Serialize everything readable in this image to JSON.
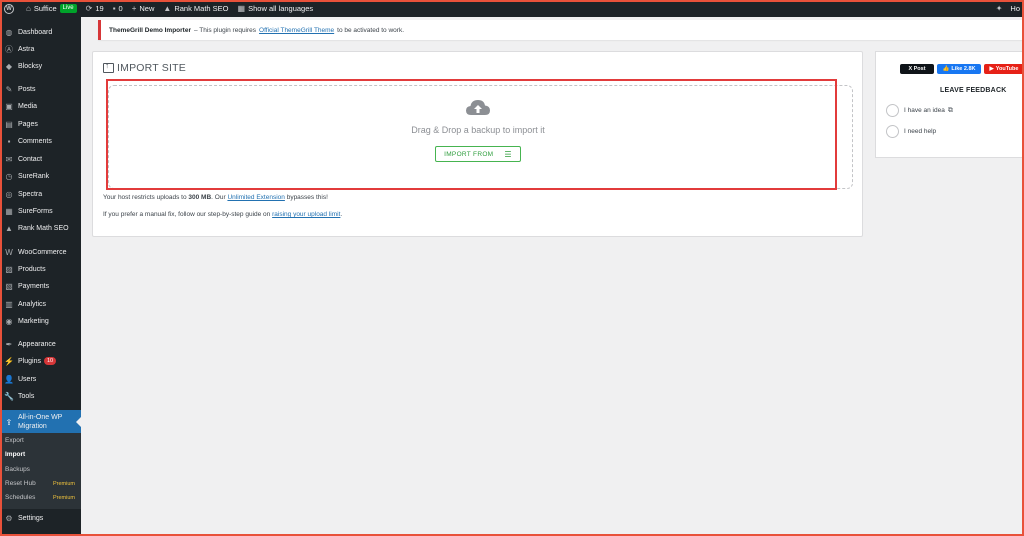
{
  "adminbar": {
    "site_name": "Suffice",
    "live_badge": "Live",
    "updates_count": "19",
    "comments_count": "0",
    "new_label": "New",
    "rankmath_label": "Rank Math SEO",
    "languages_label": "Show all languages",
    "howdy_label": "Ho"
  },
  "sidebar": {
    "items": [
      {
        "label": "Dashboard",
        "icon": "dashboard-icon"
      },
      {
        "label": "Astra",
        "icon": "astra-icon"
      },
      {
        "label": "Blocksy",
        "icon": "blocksy-icon"
      },
      {
        "label": "Posts",
        "icon": "pin-icon"
      },
      {
        "label": "Media",
        "icon": "media-icon"
      },
      {
        "label": "Pages",
        "icon": "pages-icon"
      },
      {
        "label": "Comments",
        "icon": "comments-icon"
      },
      {
        "label": "Contact",
        "icon": "mail-icon"
      },
      {
        "label": "SureRank",
        "icon": "surerank-icon"
      },
      {
        "label": "Spectra",
        "icon": "spectra-icon"
      },
      {
        "label": "SureForms",
        "icon": "sureforms-icon"
      },
      {
        "label": "Rank Math SEO",
        "icon": "rankmath-icon"
      },
      {
        "label": "WooCommerce",
        "icon": "woocommerce-icon"
      },
      {
        "label": "Products",
        "icon": "products-icon"
      },
      {
        "label": "Payments",
        "icon": "payments-icon"
      },
      {
        "label": "Analytics",
        "icon": "analytics-icon"
      },
      {
        "label": "Marketing",
        "icon": "marketing-icon"
      },
      {
        "label": "Appearance",
        "icon": "brush-icon"
      },
      {
        "label": "Plugins",
        "icon": "plugins-icon",
        "badge": "10"
      },
      {
        "label": "Users",
        "icon": "users-icon"
      },
      {
        "label": "Tools",
        "icon": "tools-icon"
      }
    ],
    "active_item": {
      "label_line1": "All-in-One WP",
      "label_line2": "Migration",
      "icon": "migration-icon"
    },
    "submenu": [
      {
        "label": "Export"
      },
      {
        "label": "Import",
        "current": true
      },
      {
        "label": "Backups"
      },
      {
        "label": "Reset Hub",
        "premium": "Premium"
      },
      {
        "label": "Schedules",
        "premium": "Premium"
      }
    ],
    "settings_label": "Settings"
  },
  "notice": {
    "title": "ThemeGrill Demo Importer",
    "text_before": "– This plugin requires",
    "link": "Official ThemeGrill Theme",
    "text_after": "to be activated to work."
  },
  "import": {
    "title": "IMPORT SITE",
    "drag_text": "Drag & Drop a backup to import it",
    "button_label": "IMPORT FROM",
    "info1_before": "Your host restricts uploads to",
    "info1_size": "300 MB",
    "info1_mid": ". Our",
    "info1_link": "Unlimited Extension",
    "info1_after": "bypasses this!",
    "info2_before": "If you prefer a manual fix, follow our step-by-step guide on",
    "info2_link": "raising your upload limit",
    "info2_after": "."
  },
  "feedback": {
    "x_label": "X Post",
    "fb_label": "Like 2.8K",
    "yt_label": "YouTube",
    "title": "LEAVE FEEDBACK",
    "option1": "I have an idea",
    "option2": "I need help"
  },
  "colors": {
    "accent": "#2271b1",
    "sidebar_bg": "#1d2327",
    "button_green": "#46b450",
    "highlight_red": "#e23b3b"
  }
}
